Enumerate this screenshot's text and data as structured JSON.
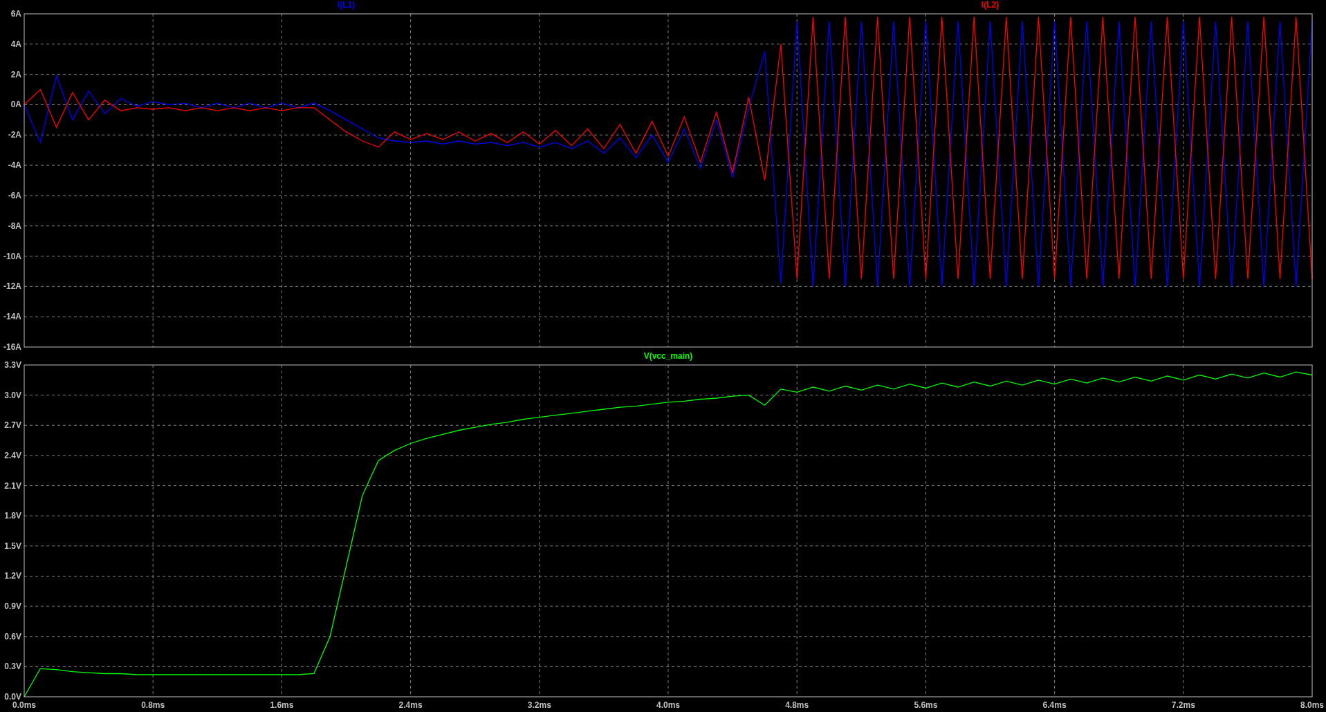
{
  "panes": [
    {
      "chart_data": {
        "type": "line",
        "xlim": [
          0,
          8
        ],
        "ylim": [
          -16,
          6
        ],
        "yticks": [
          {
            "value": 6,
            "label": "6A"
          },
          {
            "value": 4,
            "label": "4A"
          },
          {
            "value": 2,
            "label": "2A"
          },
          {
            "value": 0,
            "label": "0A"
          },
          {
            "value": -2,
            "label": "-2A"
          },
          {
            "value": -4,
            "label": "-4A"
          },
          {
            "value": -6,
            "label": "-6A"
          },
          {
            "value": -8,
            "label": "-8A"
          },
          {
            "value": -10,
            "label": "-10A"
          },
          {
            "value": -12,
            "label": "-12A"
          },
          {
            "value": -14,
            "label": "-14A"
          },
          {
            "value": -16,
            "label": "-16A"
          }
        ],
        "grid": true,
        "x": [
          0,
          0.1,
          0.2,
          0.3,
          0.4,
          0.5,
          0.6,
          0.7,
          0.8,
          0.9,
          1.0,
          1.1,
          1.2,
          1.3,
          1.4,
          1.5,
          1.6,
          1.7,
          1.8,
          1.9,
          2.0,
          2.1,
          2.2,
          2.3,
          2.4,
          2.5,
          2.6,
          2.7,
          2.8,
          2.9,
          3.0,
          3.1,
          3.2,
          3.3,
          3.4,
          3.5,
          3.6,
          3.7,
          3.8,
          3.9,
          4.0,
          4.1,
          4.2,
          4.3,
          4.4,
          4.5,
          4.6,
          4.7,
          4.8,
          4.9,
          5.0,
          5.1,
          5.2,
          5.3,
          5.4,
          5.5,
          5.6,
          5.7,
          5.8,
          5.9,
          6.0,
          6.1,
          6.2,
          6.3,
          6.4,
          6.5,
          6.6,
          6.7,
          6.8,
          6.9,
          7.0,
          7.1,
          7.2,
          7.3,
          7.4,
          7.5,
          7.6,
          7.7,
          7.8,
          7.9,
          8.0
        ],
        "series": [
          {
            "name": "I(L1)",
            "color": "#0000ff",
            "values": [
              0,
              -2.5,
              1.9,
              -1,
              0.9,
              -0.6,
              0.4,
              -0.1,
              0.2,
              0,
              0.1,
              -0.2,
              0.1,
              -0.2,
              0.1,
              -0.2,
              0.1,
              -0.2,
              0.1,
              -0.4,
              -1.0,
              -1.6,
              -2.2,
              -2.4,
              -2.5,
              -2.4,
              -2.6,
              -2.4,
              -2.6,
              -2.5,
              -2.7,
              -2.5,
              -2.8,
              -2.5,
              -2.9,
              -2.4,
              -3.2,
              -2.2,
              -3.5,
              -2.0,
              -3.8,
              -1.6,
              -4.2,
              -1.0,
              -4.8,
              -0.2,
              3.5,
              -11.8,
              5.5,
              -12,
              5.5,
              -12,
              5.5,
              -12,
              5.5,
              -12,
              5.5,
              -12,
              5.5,
              -12,
              5.5,
              -12,
              5.5,
              -12,
              5.5,
              -12,
              5.5,
              -12,
              5.5,
              -12,
              5.5,
              -12,
              5.5,
              -12,
              5.5,
              -12,
              5.5,
              -12,
              5.5,
              -12,
              5.5
            ]
          },
          {
            "name": "I(L2)",
            "color": "#ff0000",
            "values": [
              0,
              1,
              -1.5,
              0.8,
              -1,
              0.3,
              -0.4,
              -0.2,
              -0.3,
              -0.2,
              -0.4,
              -0.2,
              -0.4,
              -0.2,
              -0.4,
              -0.2,
              -0.4,
              -0.2,
              -0.2,
              -1.0,
              -1.8,
              -2.4,
              -2.8,
              -1.8,
              -2.3,
              -1.9,
              -2.3,
              -1.8,
              -2.4,
              -1.9,
              -2.5,
              -1.8,
              -2.6,
              -1.7,
              -2.7,
              -1.6,
              -2.9,
              -1.3,
              -3.2,
              -1.1,
              -3.4,
              -0.8,
              -3.8,
              -0.5,
              -4.5,
              0.5,
              -5,
              4,
              -11.5,
              5.8,
              -11.5,
              5.8,
              -11.5,
              5.8,
              -11.5,
              5.8,
              -11.5,
              5.8,
              -11.5,
              5.8,
              -11.5,
              5.8,
              -11.5,
              5.8,
              -11.5,
              5.8,
              -11.5,
              5.8,
              -11.5,
              5.8,
              -11.5,
              5.8,
              -11.5,
              5.8,
              -11.5,
              5.8,
              -11.5,
              5.8,
              -11.5,
              5.8,
              -11.5
            ]
          }
        ]
      }
    },
    {
      "chart_data": {
        "type": "line",
        "grid": true,
        "xlim": [
          0,
          8
        ],
        "ylim": [
          0,
          3.3
        ],
        "yticks": [
          {
            "value": 3.3,
            "label": "3.3V"
          },
          {
            "value": 3.0,
            "label": "3.0V"
          },
          {
            "value": 2.7,
            "label": "2.7V"
          },
          {
            "value": 2.4,
            "label": "2.4V"
          },
          {
            "value": 2.1,
            "label": "2.1V"
          },
          {
            "value": 1.8,
            "label": "1.8V"
          },
          {
            "value": 1.5,
            "label": "1.5V"
          },
          {
            "value": 1.2,
            "label": "1.2V"
          },
          {
            "value": 0.9,
            "label": "0.9V"
          },
          {
            "value": 0.6,
            "label": "0.6V"
          },
          {
            "value": 0.3,
            "label": "0.3V"
          },
          {
            "value": 0,
            "label": "0.0V"
          }
        ],
        "xticks": [
          {
            "value": 0,
            "label": "0.0ms"
          },
          {
            "value": 0.8,
            "label": "0.8ms"
          },
          {
            "value": 1.6,
            "label": "1.6ms"
          },
          {
            "value": 2.4,
            "label": "2.4ms"
          },
          {
            "value": 3.2,
            "label": "3.2ms"
          },
          {
            "value": 4.0,
            "label": "4.0ms"
          },
          {
            "value": 4.8,
            "label": "4.8ms"
          },
          {
            "value": 5.6,
            "label": "5.6ms"
          },
          {
            "value": 6.4,
            "label": "6.4ms"
          },
          {
            "value": 7.2,
            "label": "7.2ms"
          },
          {
            "value": 8.0,
            "label": "8.0ms"
          }
        ],
        "x": [
          0,
          0.1,
          0.2,
          0.3,
          0.4,
          0.5,
          0.6,
          0.7,
          0.8,
          0.9,
          1.0,
          1.1,
          1.2,
          1.3,
          1.4,
          1.5,
          1.6,
          1.7,
          1.8,
          1.9,
          2.0,
          2.1,
          2.2,
          2.3,
          2.4,
          2.5,
          2.6,
          2.7,
          2.8,
          2.9,
          3.0,
          3.1,
          3.2,
          3.3,
          3.4,
          3.5,
          3.6,
          3.7,
          3.8,
          3.9,
          4.0,
          4.1,
          4.2,
          4.3,
          4.4,
          4.5,
          4.6,
          4.7,
          4.8,
          4.9,
          5.0,
          5.1,
          5.2,
          5.3,
          5.4,
          5.5,
          5.6,
          5.7,
          5.8,
          5.9,
          6.0,
          6.1,
          6.2,
          6.3,
          6.4,
          6.5,
          6.6,
          6.7,
          6.8,
          6.9,
          7.0,
          7.1,
          7.2,
          7.3,
          7.4,
          7.5,
          7.6,
          7.7,
          7.8,
          7.9,
          8.0
        ],
        "series": [
          {
            "name": "V(vcc_main)",
            "color": "#00ff00",
            "values": [
              0,
              0.28,
              0.27,
              0.25,
              0.24,
              0.23,
              0.23,
              0.22,
              0.22,
              0.22,
              0.22,
              0.22,
              0.22,
              0.22,
              0.22,
              0.22,
              0.22,
              0.22,
              0.23,
              0.6,
              1.3,
              2.0,
              2.35,
              2.45,
              2.52,
              2.57,
              2.61,
              2.65,
              2.68,
              2.71,
              2.73,
              2.76,
              2.78,
              2.8,
              2.82,
              2.84,
              2.86,
              2.88,
              2.89,
              2.91,
              2.93,
              2.94,
              2.96,
              2.97,
              2.99,
              3.0,
              2.9,
              3.06,
              3.03,
              3.08,
              3.04,
              3.09,
              3.05,
              3.1,
              3.06,
              3.11,
              3.07,
              3.12,
              3.08,
              3.13,
              3.09,
              3.14,
              3.1,
              3.15,
              3.11,
              3.16,
              3.12,
              3.17,
              3.13,
              3.18,
              3.14,
              3.19,
              3.15,
              3.2,
              3.16,
              3.21,
              3.17,
              3.22,
              3.18,
              3.23,
              3.2
            ]
          }
        ]
      }
    }
  ]
}
